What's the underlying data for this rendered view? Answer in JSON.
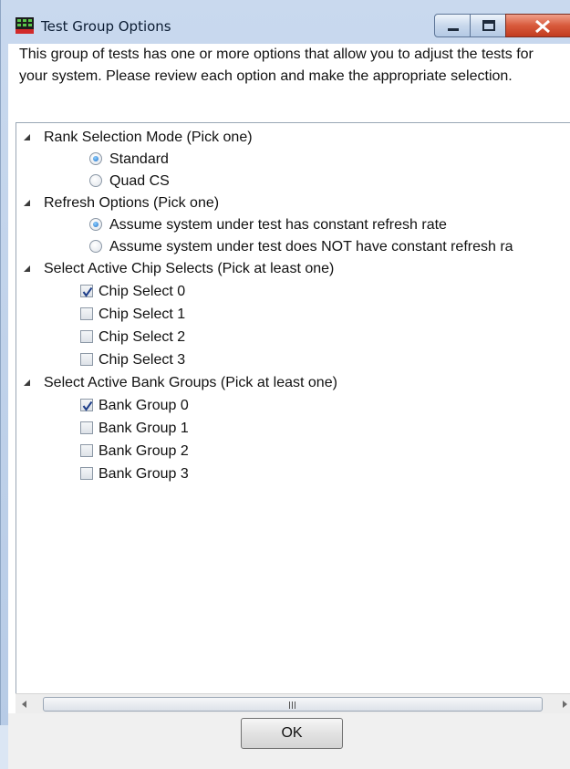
{
  "window": {
    "title": "Test Group Options",
    "icon": "app-grid-icon",
    "controls": [
      "minimize-icon",
      "maximize-icon",
      "close-icon"
    ]
  },
  "intro_text": "This group of tests has one or more options that allow you to adjust the tests for your system. Please review each option and make the appropriate selection.",
  "groups": [
    {
      "label": "Rank Selection Mode (Pick one)",
      "kind": "radio",
      "options": [
        {
          "label": "Standard",
          "selected": true
        },
        {
          "label": "Quad CS",
          "selected": false
        }
      ]
    },
    {
      "label": "Refresh Options (Pick one)",
      "kind": "radio",
      "options": [
        {
          "label": "Assume system under test has constant refresh rate",
          "selected": true
        },
        {
          "label": "Assume system under test does NOT have constant refresh ra",
          "selected": false
        }
      ]
    },
    {
      "label": "Select Active Chip Selects (Pick at least one)",
      "kind": "checkbox",
      "options": [
        {
          "label": "Chip Select 0",
          "selected": true
        },
        {
          "label": "Chip Select 1",
          "selected": false
        },
        {
          "label": "Chip Select 2",
          "selected": false
        },
        {
          "label": "Chip Select 3",
          "selected": false
        }
      ]
    },
    {
      "label": "Select Active Bank Groups (Pick at least one)",
      "kind": "checkbox",
      "options": [
        {
          "label": "Bank Group 0",
          "selected": true
        },
        {
          "label": "Bank Group 1",
          "selected": false
        },
        {
          "label": "Bank Group 2",
          "selected": false
        },
        {
          "label": "Bank Group 3",
          "selected": false
        }
      ]
    }
  ],
  "scrollbar": {
    "grip": "|||"
  },
  "footer": {
    "ok_label": "OK"
  },
  "colors": {
    "accent": "#1f6fc7",
    "close": "#c23b1f"
  }
}
